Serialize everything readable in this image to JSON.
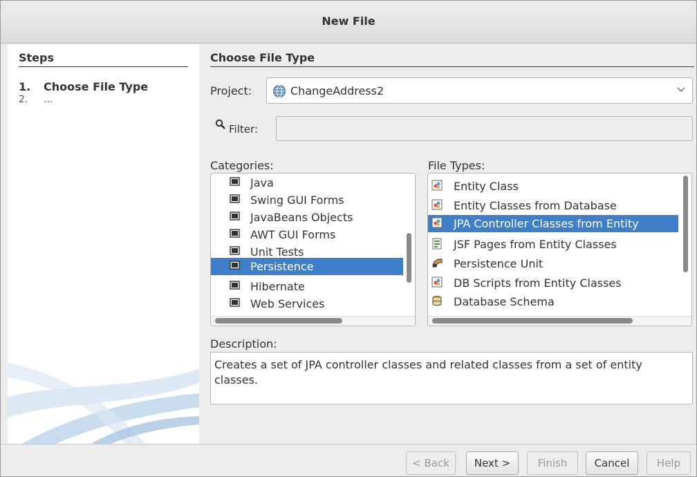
{
  "dialog": {
    "title": "New File"
  },
  "steps": {
    "heading": "Steps",
    "items": [
      {
        "num": "1.",
        "label": "Choose File Type"
      },
      {
        "num": "2.",
        "label": "..."
      }
    ]
  },
  "main": {
    "heading": "Choose File Type",
    "project_label": "Project:",
    "project_value": "ChangeAddress2",
    "filter_label": "Filter:",
    "filter_value": "",
    "categories_label": "Categories:",
    "categories": [
      "Java",
      "Swing GUI Forms",
      "JavaBeans Objects",
      "AWT GUI Forms",
      "Unit Tests",
      "Persistence",
      "Hibernate",
      "Web Services"
    ],
    "selected_category": "Persistence",
    "file_types_label": "File Types:",
    "file_types": [
      {
        "label": "Entity Class",
        "icon": "entity-class-icon"
      },
      {
        "label": "Entity Classes from Database",
        "icon": "entity-class-icon"
      },
      {
        "label": "JPA Controller Classes from Entity",
        "icon": "entity-class-icon"
      },
      {
        "label": "JSF Pages from Entity Classes",
        "icon": "jsf-page-icon"
      },
      {
        "label": "Persistence Unit",
        "icon": "persistence-unit-icon"
      },
      {
        "label": "DB Scripts from Entity Classes",
        "icon": "entity-class-icon"
      },
      {
        "label": "Database Schema",
        "icon": "database-schema-icon"
      }
    ],
    "selected_file_type": "JPA Controller Classes from Entity",
    "description_label": "Description:",
    "description": "Creates a set of JPA controller classes and related classes from a set of entity classes."
  },
  "buttons": {
    "back": "< Back",
    "next": "Next >",
    "finish": "Finish",
    "cancel": "Cancel",
    "help": "Help"
  },
  "colors": {
    "selection": "#3f7fc9",
    "panel": "#ececec"
  }
}
